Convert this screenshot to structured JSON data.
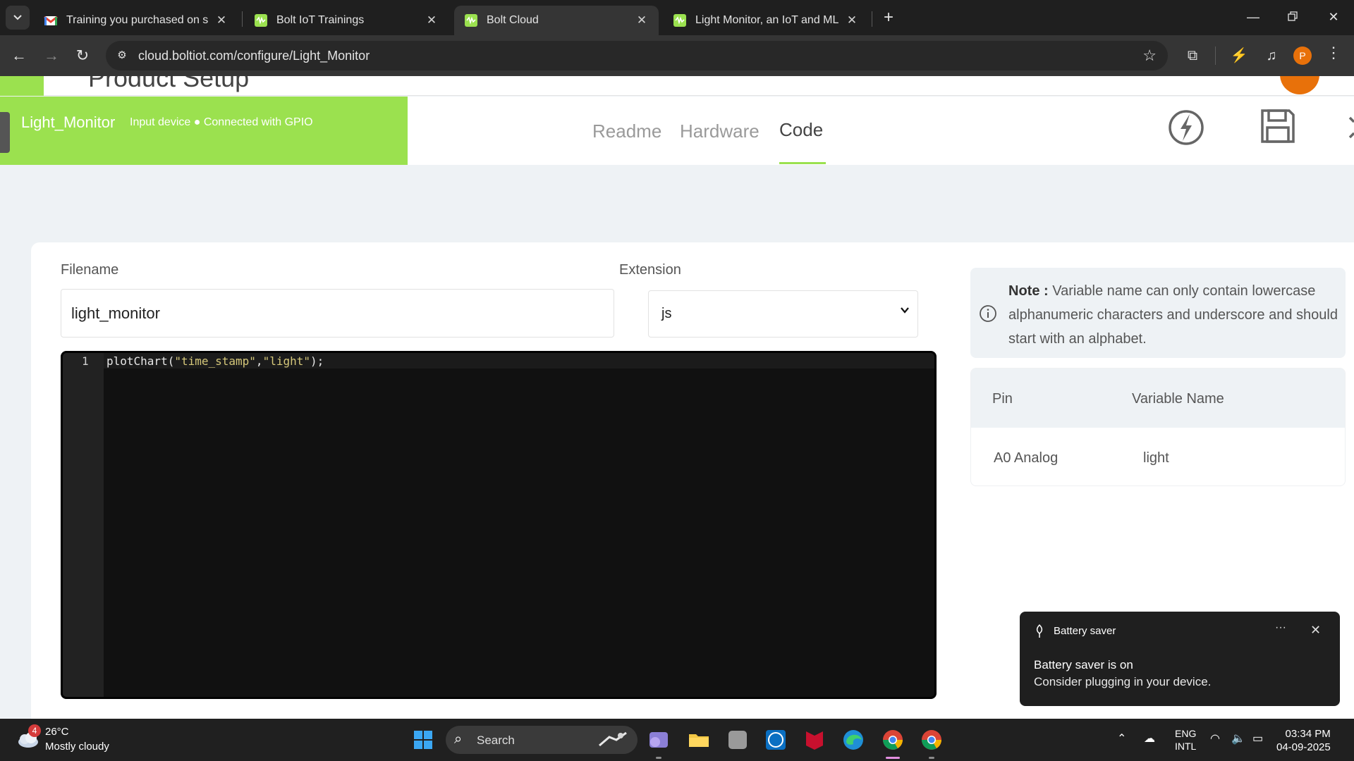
{
  "browser": {
    "tabs": [
      {
        "title": "Training you purchased on shop",
        "favicon": "gmail-icon",
        "active": false
      },
      {
        "title": "Bolt IoT Trainings",
        "favicon": "bolt-icon",
        "active": false
      },
      {
        "title": "Bolt Cloud",
        "favicon": "bolt-icon",
        "active": true
      },
      {
        "title": "Light Monitor, an IoT and ML p",
        "favicon": "bolt-icon",
        "active": false
      }
    ],
    "url": "cloud.boltiot.com/configure/Light_Monitor",
    "profile_initial": "P"
  },
  "page": {
    "cut_title": "Product Setup",
    "device": {
      "name": "Light_Monitor",
      "description": "Input device ● Connected with GPIO"
    },
    "nav": {
      "readme": "Readme",
      "hardware": "Hardware",
      "code": "Code",
      "active": "code"
    },
    "form": {
      "filename_label": "Filename",
      "filename_value": "light_monitor",
      "extension_label": "Extension",
      "extension_value": "js"
    },
    "editor": {
      "line_number": "1",
      "code_fn": "plotChart(",
      "code_arg1": "\"time_stamp\"",
      "code_comma": ",",
      "code_arg2": "\"light\"",
      "code_end": ");"
    },
    "note": {
      "label": "Note :",
      "text": " Variable name can only contain lowercase alphanumeric characters and underscore and should start with an alphabet."
    },
    "pins": {
      "header_pin": "Pin",
      "header_var": "Variable Name",
      "rows": [
        {
          "pin": "A0 Analog",
          "variable": "light"
        }
      ]
    }
  },
  "notification": {
    "app": "Battery saver",
    "title": "Battery saver is on",
    "body": "Consider plugging in your device.",
    "more": "···"
  },
  "taskbar": {
    "weather_badge": "4",
    "temperature": "26°C",
    "condition": "Mostly cloudy",
    "search_placeholder": "Search",
    "lang_top": "ENG",
    "lang_bottom": "INTL",
    "time": "03:34 PM",
    "date": "04-09-2025"
  },
  "colors": {
    "brand_green": "#9be14f",
    "chrome_dark": "#1f1f1f",
    "editor_bg": "#111111"
  }
}
